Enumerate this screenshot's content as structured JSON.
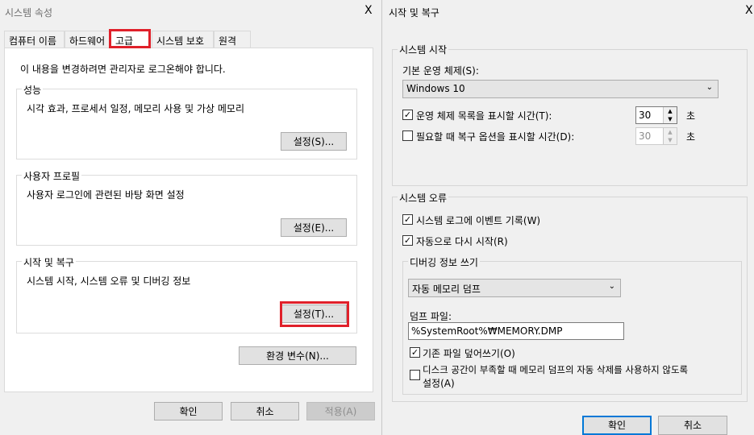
{
  "left_window": {
    "title": "시스템 속성",
    "close_glyph": "X",
    "tabs": [
      {
        "label": "컴퓨터 이름"
      },
      {
        "label": "하드웨어"
      },
      {
        "label": "고급"
      },
      {
        "label": "시스템 보호"
      },
      {
        "label": "원격"
      }
    ],
    "admin_notice": "이 내용을 변경하려면 관리자로 로그온해야 합니다.",
    "performance": {
      "title": "성능",
      "desc": "시각 효과, 프로세서 일정, 메모리 사용 및 가상 메모리",
      "button": "설정(S)..."
    },
    "user_profile": {
      "title": "사용자 프로필",
      "desc": "사용자 로그인에 관련된 바탕 화면 설정",
      "button": "설정(E)..."
    },
    "startup": {
      "title": "시작 및 복구",
      "desc": "시스템 시작, 시스템 오류 및 디버깅 정보",
      "button": "설정(T)..."
    },
    "env_button": "환경 변수(N)...",
    "ok": "확인",
    "cancel": "취소",
    "apply": "적용(A)"
  },
  "right_window": {
    "title": "시작 및 복구",
    "close_glyph": "X",
    "system_startup": {
      "title": "시스템 시작",
      "default_os_label": "기본 운영 체제(S):",
      "default_os_value": "Windows 10",
      "show_os_list": {
        "label": "운영 체제 목록을 표시할 시간(T):",
        "checked": true,
        "value": "30",
        "unit": "초"
      },
      "show_recovery": {
        "label": "필요할 때 복구 옵션을 표시할 시간(D):",
        "checked": false,
        "value": "30",
        "unit": "초"
      }
    },
    "system_failure": {
      "title": "시스템 오류",
      "write_event": {
        "label": "시스템 로그에 이벤트 기록(W)",
        "checked": true
      },
      "auto_restart": {
        "label": "자동으로 다시 시작(R)",
        "checked": true
      },
      "debug": {
        "title": "디버깅 정보 쓰기",
        "dump_type": "자동 메모리 덤프",
        "dump_file_label": "덤프 파일:",
        "dump_file_value": "%SystemRoot%₩MEMORY.DMP",
        "overwrite": {
          "label": "기존 파일 덮어쓰기(O)",
          "checked": true
        },
        "disable_auto_delete": {
          "label_line1": "디스크 공간이 부족할 때 메모리 덤프의 자동 삭제를 사용하지 않도록",
          "label_line2": "설정(A)",
          "checked": false
        }
      }
    },
    "ok": "확인",
    "cancel": "취소"
  },
  "colors": {
    "highlight": "#e0202a",
    "focus": "#0078d7",
    "window_bg": "#f0f0f0"
  }
}
